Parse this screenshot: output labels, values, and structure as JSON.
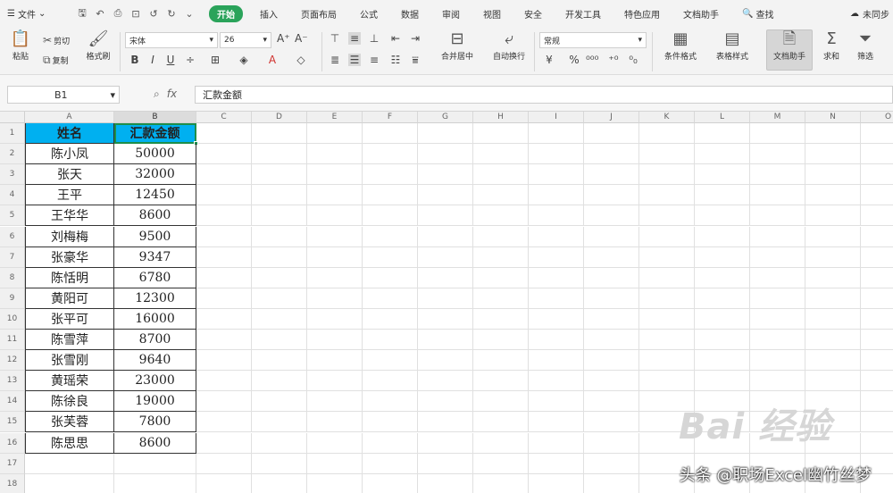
{
  "menubar": {
    "file_label": "文件",
    "tabs": [
      "开始",
      "插入",
      "页面布局",
      "公式",
      "数据",
      "审阅",
      "视图",
      "安全",
      "开发工具",
      "特色应用",
      "文档助手"
    ],
    "active_tab": "开始",
    "search_label": "查找",
    "account_label": "未同步"
  },
  "ribbon": {
    "paste": "粘贴",
    "cut": "剪切",
    "copy": "复制",
    "format_painter": "格式刷",
    "font_name": "宋体",
    "font_size": "26",
    "number_format": "常规",
    "merge_center": "合并居中",
    "wrap_text": "自动换行",
    "cond_format": "条件格式",
    "table_style": "表格样式",
    "doc_assistant": "文档助手",
    "sum": "求和",
    "filter": "筛选",
    "accent": "#2aa35a"
  },
  "formula_bar": {
    "cell_ref": "B1",
    "fx": "fx",
    "value": "汇款金额"
  },
  "sheet": {
    "columns": [
      "A",
      "B",
      "C",
      "D",
      "E",
      "F",
      "G",
      "H",
      "I",
      "J",
      "K",
      "L",
      "M",
      "N",
      "O"
    ],
    "headers": [
      "姓名",
      "汇款金额"
    ],
    "rows": [
      [
        "陈小凤",
        "50000"
      ],
      [
        "张天",
        "32000"
      ],
      [
        "王平",
        "12450"
      ],
      [
        "王华华",
        "8600"
      ],
      [
        "刘梅梅",
        "9500"
      ],
      [
        "张豪华",
        "9347"
      ],
      [
        "陈恬明",
        "6780"
      ],
      [
        "黄阳可",
        "12300"
      ],
      [
        "张平可",
        "16000"
      ],
      [
        "陈雪萍",
        "8700"
      ],
      [
        "张雪刚",
        "9640"
      ],
      [
        "黄瑶荣",
        "23000"
      ],
      [
        "陈徐良",
        "19000"
      ],
      [
        "张芙蓉",
        "7800"
      ],
      [
        "陈思思",
        "8600"
      ]
    ],
    "header_color": "#00b0f0",
    "row_numbers": [
      "1",
      "2",
      "3",
      "4",
      "5",
      "6",
      "7",
      "8",
      "9",
      "10",
      "11",
      "12",
      "13",
      "14",
      "15",
      "16",
      "17",
      "18"
    ]
  },
  "watermark": "头条 @职场Excel幽竹丝梦",
  "baidu_mark": "Bai 经验"
}
